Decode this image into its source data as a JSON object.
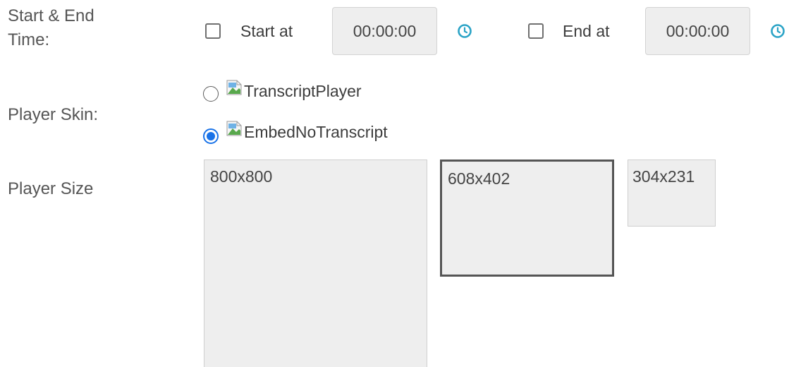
{
  "time": {
    "label_line1": "Start & End",
    "label_line2": "Time:",
    "start_label": "Start at",
    "start_value": "00:00:00",
    "end_label": "End at",
    "end_value": "00:00:00",
    "start_checked": false,
    "end_checked": false
  },
  "skin": {
    "label": "Player Skin:",
    "options": [
      {
        "label": "TranscriptPlayer",
        "selected": false
      },
      {
        "label": "EmbedNoTranscript",
        "selected": true
      }
    ]
  },
  "size": {
    "label": "Player Size",
    "options": [
      {
        "label": "800x800",
        "selected": false
      },
      {
        "label": "608x402",
        "selected": true
      },
      {
        "label": "304x231",
        "selected": false
      }
    ]
  },
  "colors": {
    "accent": "#1a73e8",
    "clock_icon": "#2aa3c6",
    "box_bg": "#eeeeee"
  },
  "icons": {
    "clock": "clock-icon",
    "broken_image": "broken-image-icon"
  }
}
